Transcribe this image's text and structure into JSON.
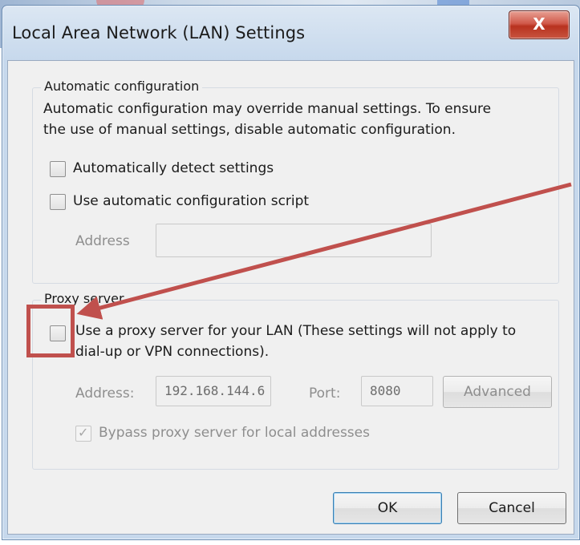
{
  "window": {
    "title": "Local Area Network (LAN) Settings",
    "close_label": "X"
  },
  "auto_config": {
    "legend": "Automatic configuration",
    "description_line1": "Automatic configuration may override manual settings.  To ensure",
    "description_line2": "the use of manual settings, disable automatic configuration.",
    "detect_label": "Automatically detect settings",
    "detect_checked": false,
    "script_label": "Use automatic configuration script",
    "script_checked": false,
    "address_label": "Address",
    "address_value": ""
  },
  "proxy": {
    "legend": "Proxy server",
    "use_proxy_line1": "Use a proxy server for your LAN (These settings will not apply to",
    "use_proxy_line2": "dial-up or VPN connections).",
    "use_proxy_checked": false,
    "address_label": "Address:",
    "address_value": "192.168.144.6",
    "port_label": "Port:",
    "port_value": "8080",
    "advanced_label": "Advanced",
    "bypass_label": "Bypass proxy server for local addresses",
    "bypass_checked": true
  },
  "buttons": {
    "ok_label": "OK",
    "cancel_label": "Cancel"
  },
  "annotation": {
    "color": "#c0504d"
  }
}
